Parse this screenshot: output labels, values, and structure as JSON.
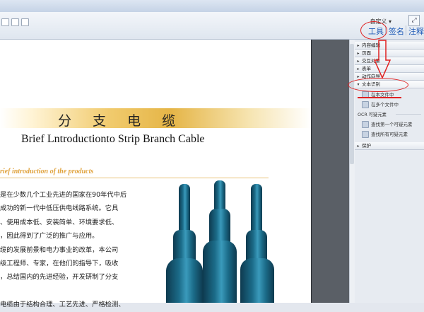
{
  "toolbar": {
    "customize_label": "自定义 ▾",
    "expand_icon": "expand-icon"
  },
  "tabs": {
    "tools": "工具",
    "sign": "签名",
    "comment": "注释"
  },
  "document": {
    "title_cn": "分 支 电 缆",
    "title_en": "Brief Lntroductionto Strip Branch Cable",
    "sub_heading": "rief introduction of the products",
    "lines": [
      "是在少数几个工业先进的国家在90年代中后",
      "成功的新一代中低压供电线路系统。它具",
      "、使用成本低、安装简单、环境要求低、",
      "，因此得到了广泛的推广与应用。",
      "缆的发展前景和电力事业的改革，本公司",
      "级工程师、专家，在他们的指导下，吸收",
      "，总结国内的先进经验，开发研制了分支",
      "",
      "电缆由于结构合理、工艺先进、严格检测、"
    ]
  },
  "panel": {
    "sections": [
      {
        "label": "内容编辑",
        "state": "collapsed"
      },
      {
        "label": "页面",
        "state": "collapsed"
      },
      {
        "label": "交互对象",
        "state": "collapsed"
      },
      {
        "label": "表单",
        "state": "collapsed"
      },
      {
        "label": "动作向导",
        "state": "collapsed"
      },
      {
        "label": "文本识别",
        "state": "expanded"
      }
    ],
    "text_recognition_items": [
      "在本文件中",
      "在多个文件中"
    ],
    "ocr_header": "OCR 可疑元素",
    "ocr_items": [
      "查找第一个可疑元素",
      "查找所有可疑元素"
    ],
    "protect_section": "保护"
  },
  "colors": {
    "annotation": "#e02020",
    "link_blue": "#1c59b6",
    "gold": "#e5b547",
    "cable": "#1b6b88"
  }
}
